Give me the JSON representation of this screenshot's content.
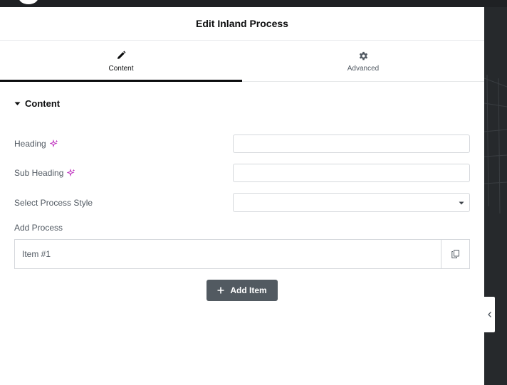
{
  "panel": {
    "title": "Edit Inland Process"
  },
  "tabs": [
    {
      "label": "Content",
      "icon": "pencil-icon",
      "active": true
    },
    {
      "label": "Advanced",
      "icon": "gear-icon",
      "active": false
    }
  ],
  "section": {
    "title": "Content",
    "toggle_icon": "caret-down-icon"
  },
  "fields": {
    "heading": {
      "label": "Heading",
      "value": "",
      "ai_icon": "sparkle-icon"
    },
    "sub_heading": {
      "label": "Sub Heading",
      "value": "",
      "ai_icon": "sparkle-icon"
    },
    "process_style": {
      "label": "Select Process Style",
      "value": ""
    },
    "add_process": {
      "label": "Add Process"
    }
  },
  "repeater": {
    "items": [
      {
        "title": "Item #1"
      }
    ],
    "duplicate_icon": "copy-icon"
  },
  "add_item": {
    "label": "Add Item",
    "icon": "plus-icon"
  },
  "colors": {
    "panel_bg": "#ffffff",
    "dark_chrome": "#1f2124",
    "button_bg": "#525a61",
    "ai_accent": "#c036c0",
    "border": "#d5d8dc"
  }
}
